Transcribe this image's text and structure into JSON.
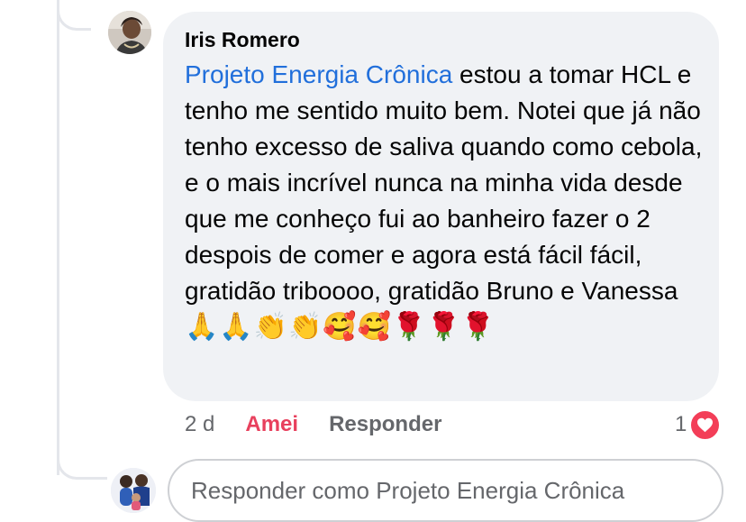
{
  "comment": {
    "author": "Iris Romero",
    "mention": "Projeto Energia Crônica",
    "text": " estou a tomar HCL e tenho me sentido muito bem. Notei que já não tenho excesso de saliva quando como cebola, e o mais incrível nunca na minha vida desde que me conheço fui ao banheiro fazer o 2 despois de comer e agora está fácil fácil, gratidão triboooo, gratidão Bruno e Vanessa ",
    "emojis": "🙏🙏👏👏🥰🥰🌹🌹🌹"
  },
  "actions": {
    "time": "2 d",
    "love_label": "Amei",
    "reply_label": "Responder"
  },
  "reaction": {
    "count": "1",
    "icon": "heart-icon",
    "color": "#f33e58"
  },
  "reply_input": {
    "placeholder": "Responder como Projeto Energia Crônica",
    "value": ""
  },
  "colors": {
    "link": "#216fdb",
    "love": "#e8405d",
    "bubble": "#f0f2f5",
    "muted": "#65676b"
  }
}
